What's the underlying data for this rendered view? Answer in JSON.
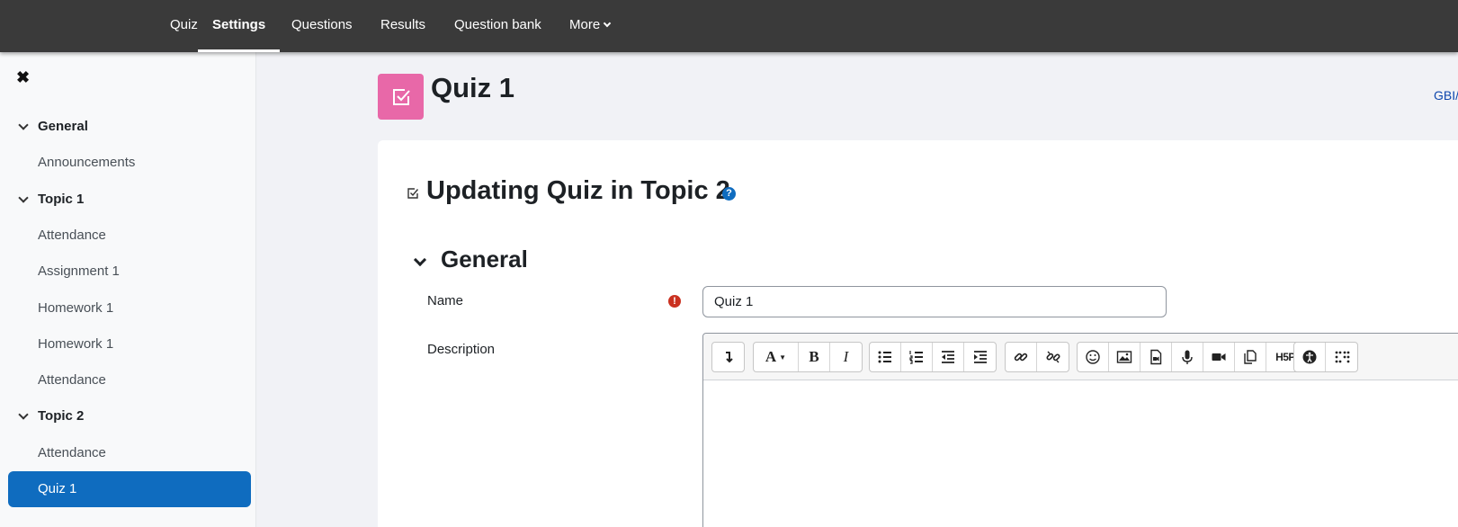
{
  "nav": {
    "tabs": [
      {
        "label": "Quiz"
      },
      {
        "label": "Settings"
      },
      {
        "label": "Questions"
      },
      {
        "label": "Results"
      },
      {
        "label": "Question bank"
      },
      {
        "label": "More"
      }
    ]
  },
  "sidebar": {
    "close_glyph": "✖",
    "items": [
      {
        "label": "General",
        "kind": "section"
      },
      {
        "label": "Announcements",
        "kind": "activity"
      },
      {
        "label": "Topic 1",
        "kind": "section"
      },
      {
        "label": "Attendance",
        "kind": "activity"
      },
      {
        "label": "Assignment 1",
        "kind": "activity"
      },
      {
        "label": "Homework 1",
        "kind": "activity"
      },
      {
        "label": "Homework 1",
        "kind": "activity"
      },
      {
        "label": "Attendance",
        "kind": "activity"
      },
      {
        "label": "Topic 2",
        "kind": "section"
      },
      {
        "label": "Attendance",
        "kind": "activity"
      },
      {
        "label": "Quiz 1",
        "kind": "activity",
        "selected": true
      }
    ]
  },
  "header": {
    "title": "Quiz 1",
    "link_text": "GBI/"
  },
  "form": {
    "heading": "Updating Quiz in Topic 2",
    "help_glyph": "?",
    "section_title": "General",
    "name_label": "Name",
    "required_glyph": "!",
    "name_value": "Quiz 1",
    "description_label": "Description",
    "toolbar_text": {
      "bold": "B",
      "italic": "I",
      "font": "A",
      "h5p": "H5P"
    }
  },
  "colors": {
    "nav_bg": "#3a3a3a",
    "accent": "#0f6cbf",
    "quiz_icon_bg": "#e868a8",
    "required": "#ca3120"
  }
}
